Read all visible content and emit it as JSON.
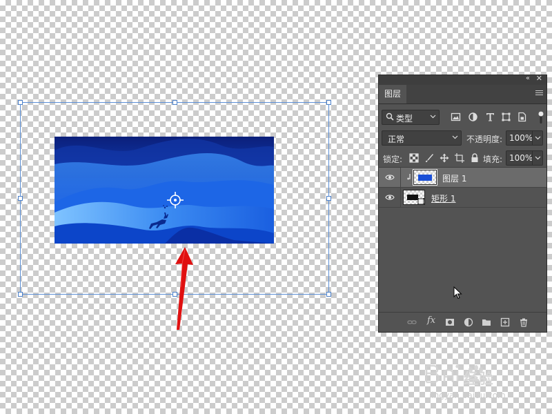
{
  "canvas": {
    "transform_handles": 8,
    "selection_color": "#5b8fd6",
    "annotation_arrow_color": "#e01010"
  },
  "layers_panel": {
    "tab": "图层",
    "filter": {
      "kind_label": "类型",
      "icons": [
        "image-filter-icon",
        "adjustment-filter-icon",
        "type-filter-icon",
        "shape-filter-icon",
        "smart-object-filter-icon"
      ]
    },
    "blend_mode": "正常",
    "opacity_label": "不透明度:",
    "opacity_value": "100%",
    "lock_label": "锁定:",
    "fill_label": "填充:",
    "fill_value": "100%",
    "layers": [
      {
        "name": "图层 1",
        "visible": true,
        "selected": true,
        "clipped": true
      },
      {
        "name": "矩形 1",
        "visible": true,
        "selected": false,
        "clipped": false
      }
    ],
    "footer_icons": [
      "link-icon",
      "fx-icon",
      "mask-icon",
      "adjustment-layer-icon",
      "group-folder-icon",
      "new-layer-icon",
      "trash-icon"
    ]
  },
  "watermark": {
    "text": "经验",
    "url": "jingyan.baidu.com"
  },
  "colors": {
    "panel_bg": "#535353",
    "panel_dark": "#424242",
    "selected_row": "#6b6b6b",
    "art_blue": "#0a3fd0"
  }
}
